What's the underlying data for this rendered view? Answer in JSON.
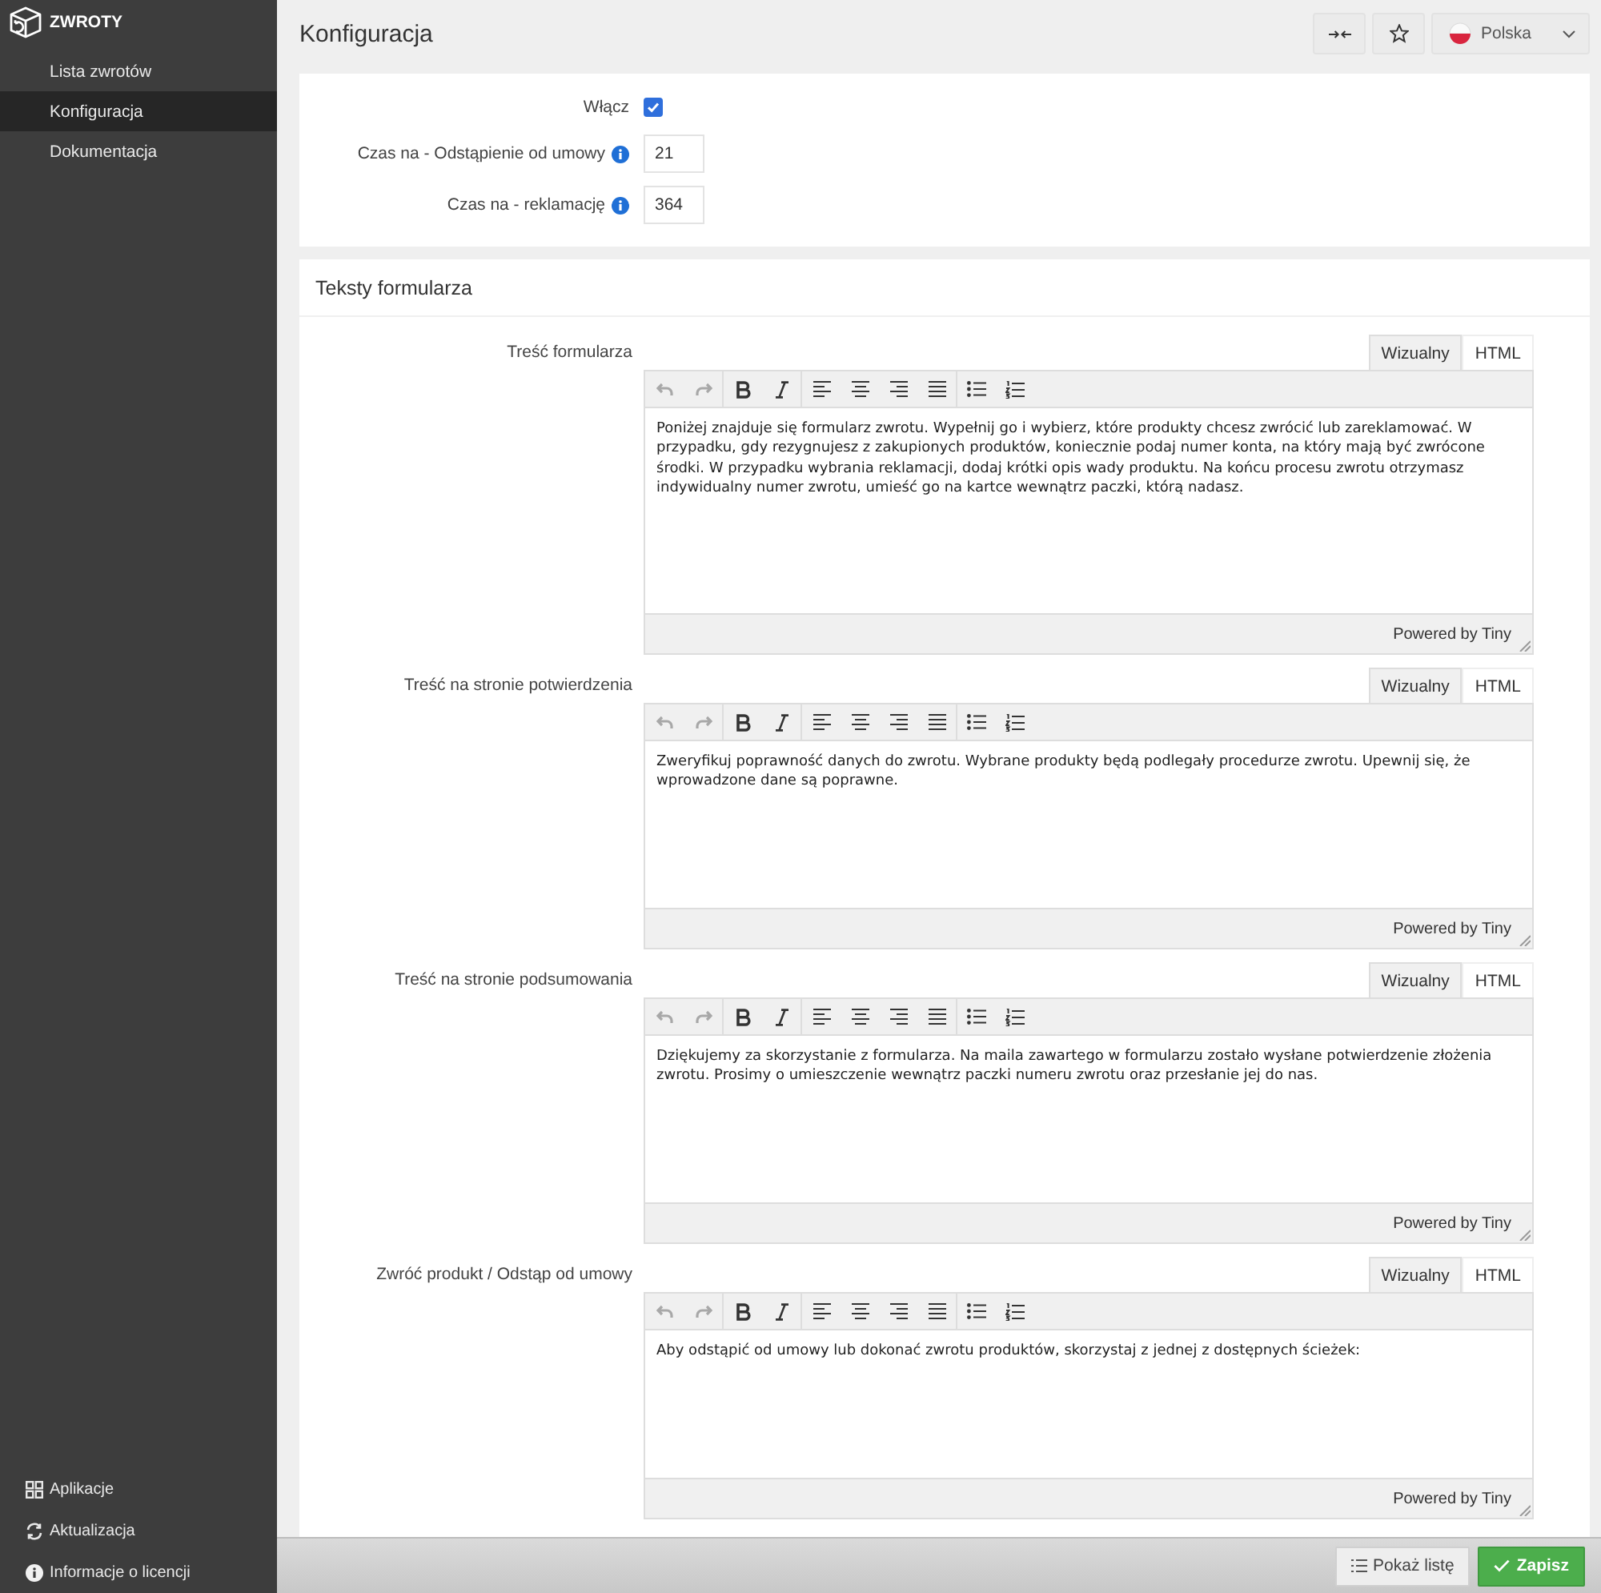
{
  "sidebar": {
    "logo": {
      "title": "ZWROTY"
    },
    "items": [
      {
        "label": "Lista zwrotów",
        "selected": false
      },
      {
        "label": "Konfiguracja",
        "selected": true
      },
      {
        "label": "Dokumentacja",
        "selected": false
      }
    ],
    "footer_items": [
      {
        "label": "Aplikacje"
      },
      {
        "label": "Aktualizacja"
      },
      {
        "label": "Informacje o licencji"
      }
    ]
  },
  "header": {
    "title": "Konfiguracja",
    "language": {
      "value": "Polska"
    }
  },
  "settings": [
    {
      "kind": "checkbox",
      "label": "Włącz",
      "checked": true
    },
    {
      "kind": "number",
      "label": "Czas na - Odstąpienie od umowy",
      "value": "21"
    },
    {
      "kind": "number",
      "label": "Czas na - reklamację",
      "value": "364"
    }
  ],
  "form_texts": {
    "title": "Teksty formularza",
    "editors": [
      {
        "label": "Treść formularza",
        "tabs": [
          {
            "label": "Wizualny",
            "selected": true
          },
          {
            "label": "HTML",
            "selected": false
          }
        ],
        "undo_disabled": true,
        "redo_disabled": true,
        "content": "Poniżej znajduje się formularz zwrotu. Wypełnij go i wybierz, które produkty chcesz zwrócić lub zareklamować. W przypadku, gdy rezygnujesz z zakupionych produktów, koniecznie podaj numer konta, na który mają być zwrócone środki. W przypadku wybrania reklamacji, dodaj krótki opis wady produktu. Na końcu procesu zwrotu otrzymasz indywidualny numer zwrotu, umieść go na kartce wewnątrz paczki, którą nadasz.",
        "status": "Powered by Tiny"
      },
      {
        "label": "Treść na stronie potwierdzenia",
        "tabs": [
          {
            "label": "Wizualny",
            "selected": true
          },
          {
            "label": "HTML",
            "selected": false
          }
        ],
        "undo_disabled": true,
        "redo_disabled": true,
        "content": "Zweryfikuj poprawność danych do zwrotu. Wybrane produkty będą podlegały procedurze zwrotu. Upewnij się, że wprowadzone dane są poprawne.",
        "status": "Powered by Tiny"
      },
      {
        "label": "Treść na stronie podsumowania",
        "tabs": [
          {
            "label": "Wizualny",
            "selected": true
          },
          {
            "label": "HTML",
            "selected": false
          }
        ],
        "undo_disabled": true,
        "redo_disabled": true,
        "content": "Dziękujemy za skorzystanie z formularza. Na maila zawartego w formularzu zostało wysłane potwierdzenie złożenia zwrotu. Prosimy o umieszczenie wewnątrz paczki numeru zwrotu oraz przesłanie jej do nas.",
        "status": "Powered by Tiny"
      },
      {
        "label": "Zwróć produkt / Odstąp od umowy",
        "tabs": [
          {
            "label": "Wizualny",
            "selected": true
          },
          {
            "label": "HTML",
            "selected": false
          }
        ],
        "undo_disabled": true,
        "redo_disabled": true,
        "content": "Aby odstąpić od umowy lub dokonać zwrotu produktów, skorzystaj z jednej z dostępnych ścieżek:",
        "status": "Powered by Tiny"
      }
    ]
  },
  "footer": {
    "buttons": [
      {
        "label": "Pokaż listę",
        "kind": "secondary"
      },
      {
        "label": "Zapisz",
        "kind": "primary"
      }
    ]
  }
}
